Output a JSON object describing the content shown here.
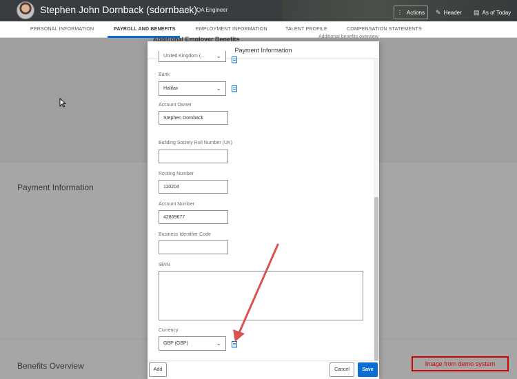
{
  "header": {
    "person_name": "Stephen John Dornback (sdornback)",
    "role": "QA Engineer",
    "actions_label": "Actions",
    "header_label": "Header",
    "as_of_label": "As of Today"
  },
  "tabs": [
    {
      "label": "PERSONAL INFORMATION",
      "active": false
    },
    {
      "label": "PAYROLL AND BENEFITS",
      "active": true
    },
    {
      "label": "EMPLOYMENT INFORMATION",
      "active": false
    },
    {
      "label": "TALENT PROFILE",
      "active": false
    },
    {
      "label": "COMPENSATION STATEMENTS",
      "active": false
    }
  ],
  "background": {
    "section_partial": "Additional Employer Benefits",
    "section_partial_right": "Additional benefits overview",
    "payment_information": "Payment Information",
    "benefits_overview": "Benefits Overview"
  },
  "dialog": {
    "title": "Payment Information",
    "country_value": "United Kingdom (...",
    "bank_label": "Bank",
    "bank_value": "Halifax",
    "account_owner_label": "Account Owner",
    "account_owner_value": "Stephen Dornback",
    "roll_number_label": "Building Society Roll Number (UK)",
    "roll_number_value": "",
    "routing_number_label": "Routing Number",
    "routing_number_value": "110204",
    "account_number_label": "Account Number",
    "account_number_value": "42869677",
    "bic_label": "Business Identifier Code",
    "bic_value": "",
    "iban_label": "IBAN",
    "iban_value": "",
    "currency_label": "Currency",
    "currency_value": "GBP (GBP)",
    "add_label": "Add",
    "cancel_label": "Cancel",
    "save_label": "Save"
  },
  "annotation": {
    "watermark": "Image from demo system"
  },
  "colors": {
    "accent": "#0a6ed1",
    "annotation": "#d40000"
  }
}
